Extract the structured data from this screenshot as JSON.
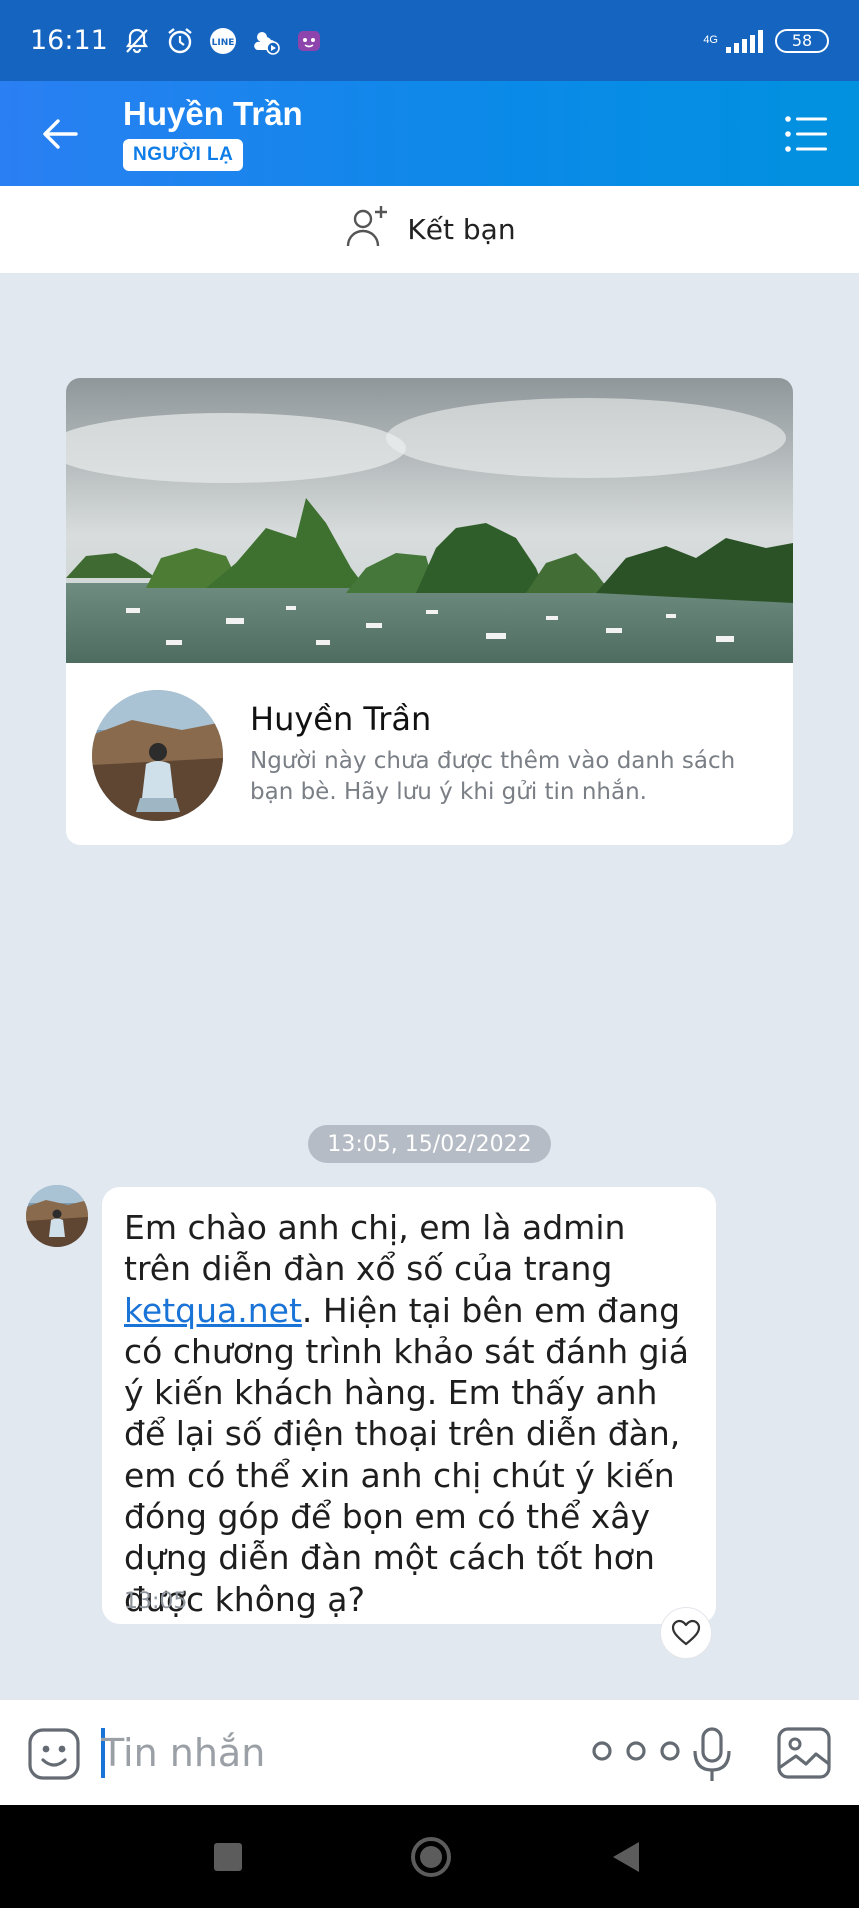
{
  "status_bar": {
    "time": "16:11",
    "network": "4G",
    "battery": "58",
    "icons": [
      "bell-off-icon",
      "alarm-icon",
      "line-app-icon",
      "weather-icon",
      "app-icon"
    ]
  },
  "header": {
    "title": "Huyền Trần",
    "badge": "NGƯỜI LẠ",
    "back_icon": "arrow-left-icon",
    "menu_icon": "list-menu-icon"
  },
  "add_friend": {
    "label": "Kết bạn",
    "icon": "add-person-icon"
  },
  "profile_card": {
    "name": "Huyền Trần",
    "description": "Người này chưa được thêm vào danh sách bạn bè. Hãy lưu ý khi gửi tin nhắn."
  },
  "chat": {
    "date_time": "13:05, 15/02/2022",
    "message": {
      "text_before_link": "Em chào anh chị, em là admin trên diễn đàn xổ số của trang ",
      "link": "ketqua.net",
      "text_after_link": ". Hiện tại bên em đang có chương trình khảo sát đánh giá ý kiến khách hàng. Em thấy anh để lại số điện thoại trên diễn đàn, em có thể xin anh chị chút ý kiến đóng góp để bọn em có thể xây dựng diễn đàn một cách tốt hơn được không ạ?",
      "time": "13:05"
    }
  },
  "input_bar": {
    "placeholder": "Tin nhắn"
  },
  "colors": {
    "header_start": "#2a7ff2",
    "header_end": "#0191df",
    "link": "#1a73d6",
    "chat_background": "#e2e8f0"
  }
}
